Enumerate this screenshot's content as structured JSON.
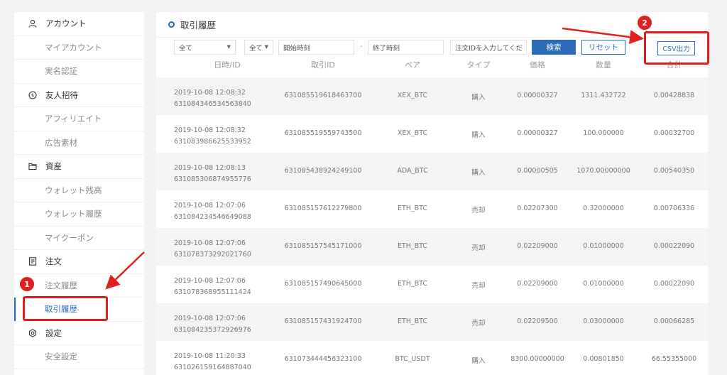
{
  "sidebar": {
    "account": "アカウント",
    "my_account": "マイアカウント",
    "identity": "実名認証",
    "referral": "友人招待",
    "affiliate": "アフィリエイト",
    "ad_material": "広告素材",
    "assets": "資産",
    "wallet_balance": "ウォレット残高",
    "wallet_history": "ウォレット履歴",
    "coupon": "マイクーポン",
    "orders": "注文",
    "order_history": "注文履歴",
    "trade_history": "取引履歴",
    "settings": "設定",
    "security": "安全設定"
  },
  "main": {
    "title": "取引履歴"
  },
  "filters": {
    "select1": "全て",
    "select2": "全て",
    "start_placeholder": "開始時刻",
    "dash": "-",
    "end_placeholder": "終了時刻",
    "order_id_placeholder": "注文IDを入力してくだ",
    "search": "検索",
    "reset": "リセット",
    "csv": "CSV出力"
  },
  "table": {
    "headers": [
      "日時/ID",
      "取引ID",
      "ペア",
      "タイプ",
      "価格",
      "数量",
      "合計"
    ],
    "rows": [
      {
        "date": "2019-10-08 12:08:32",
        "id": "631084346534563840",
        "trade_id": "631085519618463700",
        "pair": "XEX_BTC",
        "type": "購入",
        "price": "0.00000327",
        "qty": "1311.432722",
        "total": "0.00428838"
      },
      {
        "date": "2019-10-08 12:08:32",
        "id": "631083986625533952",
        "trade_id": "631085519559743500",
        "pair": "XEX_BTC",
        "type": "購入",
        "price": "0.00000327",
        "qty": "100.000000",
        "total": "0.00032700"
      },
      {
        "date": "2019-10-08 12:08:13",
        "id": "631085306874955776",
        "trade_id": "631085438924249100",
        "pair": "ADA_BTC",
        "type": "購入",
        "price": "0.00000505",
        "qty": "1070.00000000",
        "total": "0.00540350"
      },
      {
        "date": "2019-10-08 12:07:06",
        "id": "631084234546649088",
        "trade_id": "631085157612279800",
        "pair": "ETH_BTC",
        "type": "売却",
        "price": "0.02207300",
        "qty": "0.32000000",
        "total": "0.00706336"
      },
      {
        "date": "2019-10-08 12:07:06",
        "id": "631078373292021760",
        "trade_id": "631085157545171000",
        "pair": "ETH_BTC",
        "type": "売却",
        "price": "0.02209000",
        "qty": "0.01000000",
        "total": "0.00022090"
      },
      {
        "date": "2019-10-08 12:07:06",
        "id": "631078368955111424",
        "trade_id": "631085157490645000",
        "pair": "ETH_BTC",
        "type": "売却",
        "price": "0.02209000",
        "qty": "0.01000000",
        "total": "0.00022090"
      },
      {
        "date": "2019-10-08 12:07:06",
        "id": "631084235372926976",
        "trade_id": "631085157431924700",
        "pair": "ETH_BTC",
        "type": "売却",
        "price": "0.02209500",
        "qty": "0.03000000",
        "total": "0.00066285"
      },
      {
        "date": "2019-10-08 11:20:33",
        "id": "631026159164887040",
        "trade_id": "631073444456323100",
        "pair": "BTC_USDT",
        "type": "購入",
        "price": "8300.00000000",
        "qty": "0.00801850",
        "total": "66.55355000"
      }
    ]
  },
  "annotations": {
    "badge1": "1",
    "badge2": "2",
    "color": "#e02020"
  }
}
